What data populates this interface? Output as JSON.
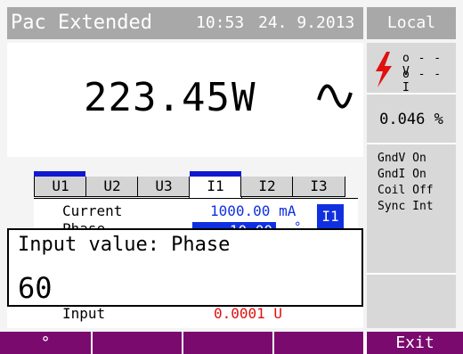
{
  "header": {
    "app_title": "Pac Extended",
    "time": "10:53",
    "date": "24. 9.2013",
    "mode": "Local"
  },
  "reading": {
    "value": "223.45",
    "unit": "W",
    "waveform_icon": "sine-wave-icon"
  },
  "right_panel": {
    "terminal_icon": "lightning-bolt-icon",
    "terminal_lines": [
      "o - - V",
      "o - - I"
    ],
    "accuracy": "0.046 %",
    "status": [
      "GndV On",
      "GndI On",
      "Coil Off",
      "Sync Int"
    ]
  },
  "tabs": {
    "items": [
      "U1",
      "U2",
      "U3",
      "I1",
      "I2",
      "I3"
    ],
    "active": "I1"
  },
  "panel": {
    "rows": [
      {
        "label": "Current",
        "value": "1000.00 mA"
      },
      {
        "label": "Phase",
        "value": "10.00",
        "unit": "°"
      }
    ],
    "channel_badge": "I1"
  },
  "dialog": {
    "title": "Input value:  Phase",
    "value": "60"
  },
  "underlayer": {
    "label": "Input",
    "value": "0.0001  U"
  },
  "softkeys": [
    "°",
    "",
    "",
    "",
    "Exit"
  ],
  "colors": {
    "header_bg": "#a8a8a8",
    "accent_blue": "#1030e0",
    "softkey_purple": "#7a0a6e",
    "alert_red": "#e01010"
  }
}
